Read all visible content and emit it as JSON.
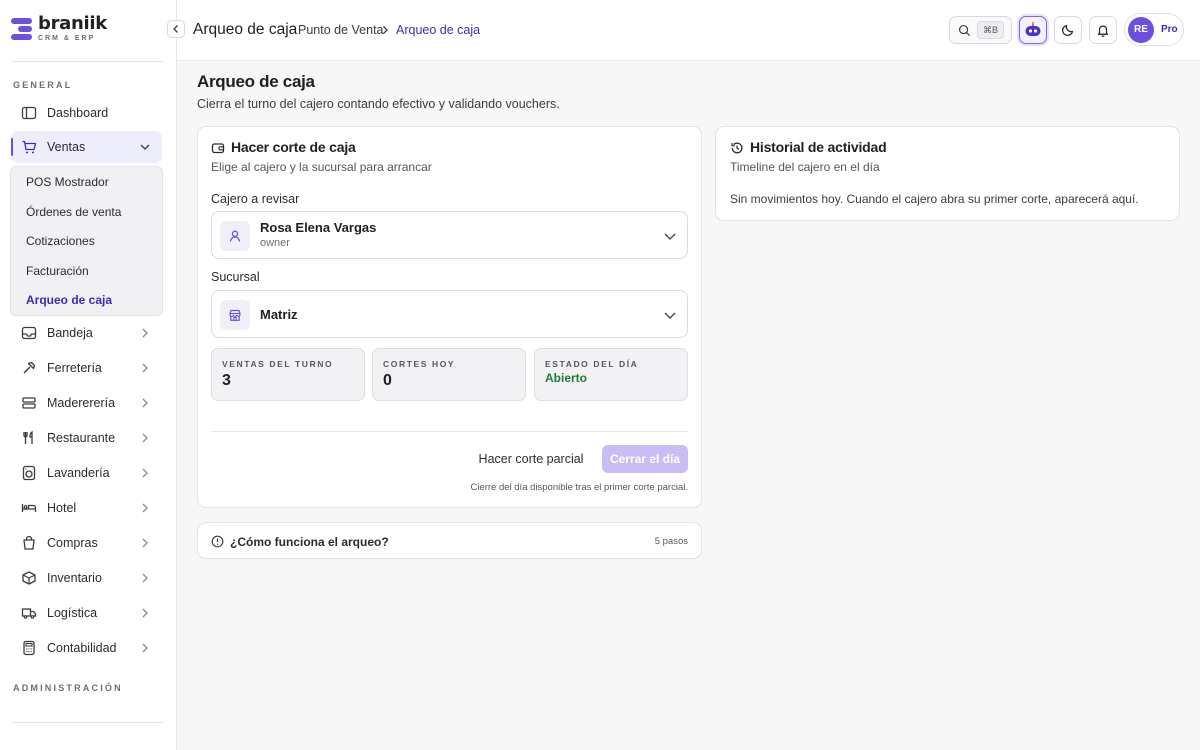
{
  "brand": {
    "name": "braniik",
    "tagline": "CRM & ERP",
    "accent": "#6d4fe0"
  },
  "sidebar": {
    "section_general": "GENERAL",
    "section_admin": "ADMINISTRACIÓN",
    "dashboard": "Dashboard",
    "ventas": "Ventas",
    "submenu": [
      "POS Mostrador",
      "Órdenes de venta",
      "Cotizaciones",
      "Facturación",
      "Arqueo de caja"
    ],
    "items": [
      {
        "label": "Bandeja",
        "icon": "inbox-icon"
      },
      {
        "label": "Ferretería",
        "icon": "hammer-icon"
      },
      {
        "label": "Madererería",
        "icon": "wood-icon"
      },
      {
        "label": "Restaurante",
        "icon": "utensils-icon"
      },
      {
        "label": "Lavandería",
        "icon": "washer-icon"
      },
      {
        "label": "Hotel",
        "icon": "bed-icon"
      },
      {
        "label": "Compras",
        "icon": "bag-icon"
      },
      {
        "label": "Inventario",
        "icon": "box-icon"
      },
      {
        "label": "Logística",
        "icon": "truck-icon"
      },
      {
        "label": "Contabilidad",
        "icon": "calculator-icon"
      }
    ]
  },
  "topbar": {
    "title": "Arqueo de caja",
    "breadcrumb": [
      "Punto de Venta",
      "Arqueo de caja"
    ],
    "search_shortcut": "⌘B",
    "user_initials": "RE",
    "plan": "Pro"
  },
  "page": {
    "title": "Arqueo de caja",
    "subtitle": "Cierra el turno del cajero contando efectivo y validando vouchers."
  },
  "corte": {
    "title": "Hacer corte de caja",
    "subtitle": "Elige al cajero y la sucursal para arrancar",
    "cashier_label": "Cajero a revisar",
    "cashier_name": "Rosa Elena Vargas",
    "cashier_role": "owner",
    "branch_label": "Sucursal",
    "branch_name": "Matriz",
    "stats": [
      {
        "label": "VENTAS DEL TURNO",
        "value": "3"
      },
      {
        "label": "CORTES HOY",
        "value": "0"
      },
      {
        "label": "ESTADO DEL DÍA",
        "value": "Abierto",
        "color": "#19803a"
      }
    ],
    "partial_button": "Hacer corte parcial",
    "close_button": "Cerrar el día",
    "note": "Cierre del día disponible tras el primer corte parcial."
  },
  "historial": {
    "title": "Historial de actividad",
    "subtitle": "Timeline del cajero en el día",
    "empty": "Sin movimientos hoy. Cuando el cajero abra su primer corte, aparecerá aquí."
  },
  "help": {
    "question": "¿Cómo funciona el arqueo?",
    "steps": "5 pasos"
  }
}
